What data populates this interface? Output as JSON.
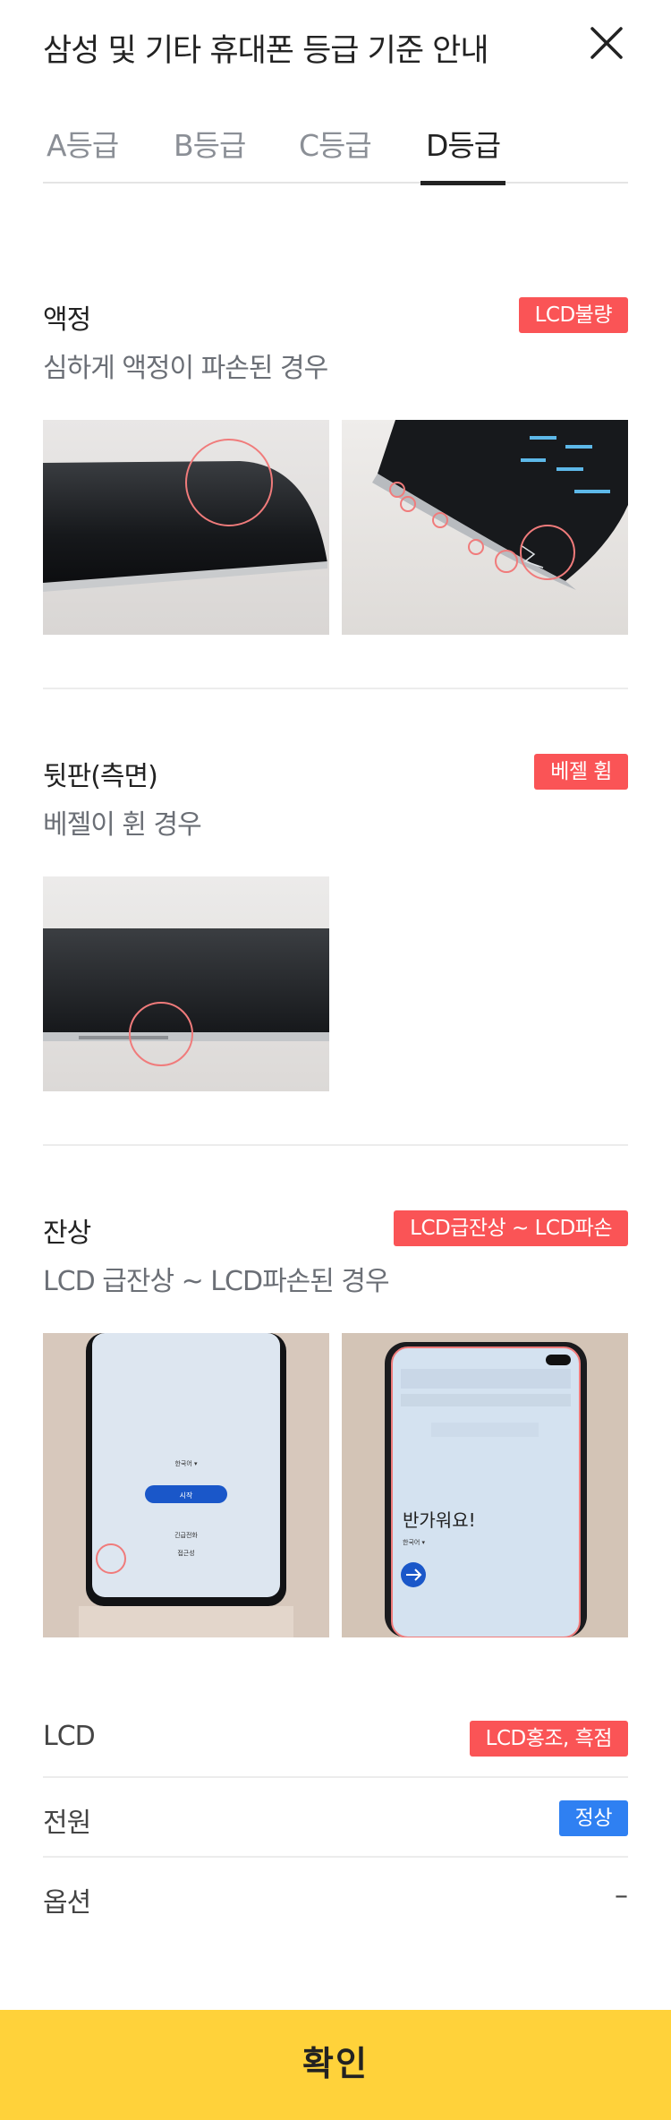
{
  "header": {
    "title": "삼성 및 기타 휴대폰 등급 기준 안내",
    "close_icon": "close-icon"
  },
  "tabs": [
    {
      "label": "A등급",
      "active": false
    },
    {
      "label": "B등급",
      "active": false
    },
    {
      "label": "C등급",
      "active": false
    },
    {
      "label": "D등급",
      "active": true
    }
  ],
  "sections": [
    {
      "title": "액정",
      "badge": "LCD불량",
      "description": "심하게 액정이 파손된 경우",
      "photos": [
        "phone-screen-edge-photo",
        "phone-cracked-screen-photo"
      ]
    },
    {
      "title": "뒷판(측면)",
      "badge": "베젤 휨",
      "description": "베젤이 휜 경우",
      "photos": [
        "phone-bent-bezel-photo"
      ]
    },
    {
      "title": "잔상",
      "badge": "LCD급잔상 ~ LCD파손",
      "description": "LCD 급잔상 ~ LCD파손된 경우",
      "photos": [
        "phone-setup-screen-photo",
        "phone-burn-in-screen-photo"
      ]
    }
  ],
  "screen_text": {
    "language": "한국어 ▾",
    "start": "시작",
    "emergency": "긴급전화",
    "accessibility": "접근성",
    "welcome": "반가워요!",
    "language2": "한국어 ▾"
  },
  "summary": [
    {
      "label": "LCD",
      "badge": "LCD홍조, 흑점",
      "badge_color": "#fa5456"
    },
    {
      "label": "전원",
      "badge": "정상",
      "badge_color": "#2f80f2"
    },
    {
      "label": "옵션",
      "value": "–"
    }
  ],
  "confirm_label": "확인",
  "colors": {
    "accent": "#ffd23a",
    "badge_red": "#fa5456",
    "badge_blue": "#2f80f2",
    "marker": "#f07b7b"
  }
}
